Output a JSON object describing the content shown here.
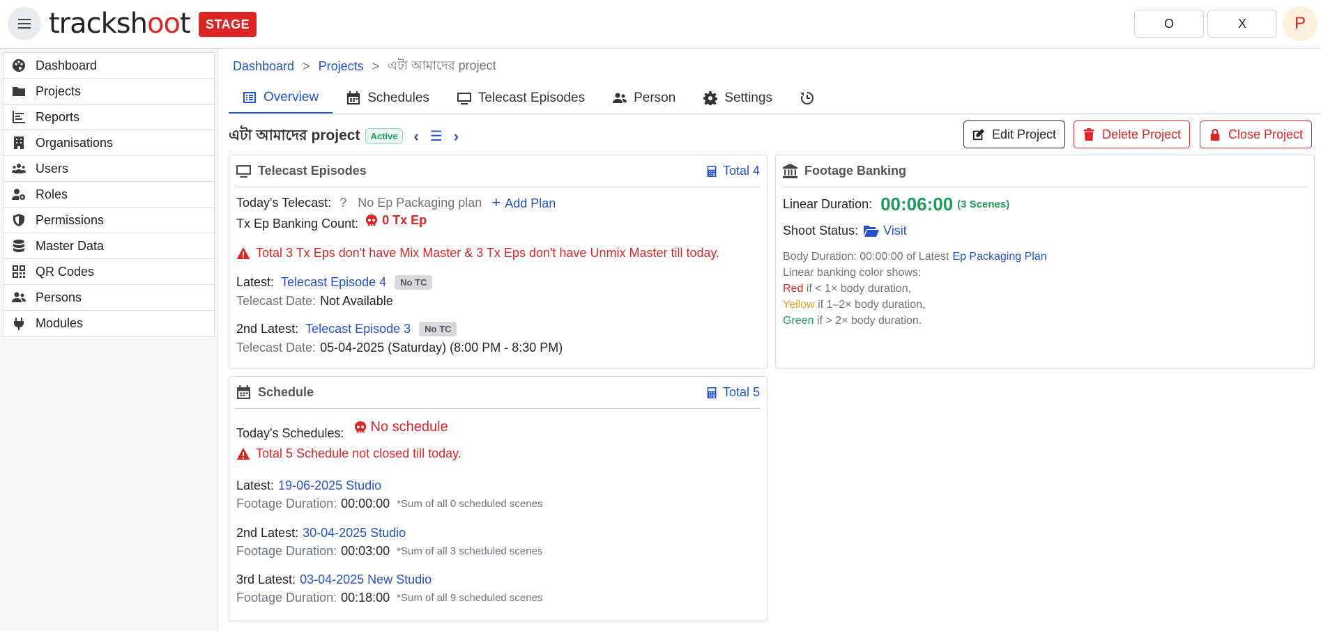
{
  "header": {
    "logo_text_a": "tracksh",
    "logo_text_b": "oo",
    "logo_text_c": "t",
    "stage_label": "STAGE",
    "btn_o_label": "O",
    "btn_x_label": "X",
    "avatar_letter": "P"
  },
  "sidebar": {
    "items": [
      {
        "label": "Dashboard",
        "icon": "palette-icon"
      },
      {
        "label": "Projects",
        "icon": "folder-icon"
      },
      {
        "label": "Reports",
        "icon": "chart-bar-icon"
      },
      {
        "label": "Organisations",
        "icon": "building-icon"
      },
      {
        "label": "Users",
        "icon": "users-icon"
      },
      {
        "label": "Roles",
        "icon": "user-gear-icon"
      },
      {
        "label": "Permissions",
        "icon": "shield-icon"
      },
      {
        "label": "Master Data",
        "icon": "database-icon"
      },
      {
        "label": "QR Codes",
        "icon": "qrcode-icon"
      },
      {
        "label": "Persons",
        "icon": "user-group-icon"
      },
      {
        "label": "Modules",
        "icon": "plug-icon"
      }
    ]
  },
  "breadcrumb": {
    "home": "Dashboard",
    "projects": "Projects",
    "current": "এটা আমাদের project",
    "sep": ">"
  },
  "tabs": [
    {
      "label": "Overview",
      "icon": "list-alt-icon",
      "active": true
    },
    {
      "label": "Schedules",
      "icon": "calendar-icon"
    },
    {
      "label": "Telecast Episodes",
      "icon": "tv-icon"
    },
    {
      "label": "Person",
      "icon": "user-group-icon"
    },
    {
      "label": "Settings",
      "icon": "gear-icon"
    },
    {
      "label": "",
      "icon": "history-icon"
    }
  ],
  "project": {
    "title": "এটা আমাদের project",
    "status": "Active",
    "edit_label": "Edit Project",
    "delete_label": "Delete Project",
    "close_label": "Close Project"
  },
  "telecast": {
    "title": "Telecast Episodes",
    "total": "Total 4",
    "todays_label": "Today's Telecast:",
    "todays_q": "?",
    "no_plan": "No Ep Packaging plan",
    "add_plan": "Add Plan",
    "banking_label": "Tx Ep Banking Count:",
    "banking_value": "0 Tx Ep",
    "warning": "Total 3 Tx Eps don't have Mix Master & 3 Tx Eps don't have Unmix Master till today.",
    "latest_label": "Latest:",
    "latest_ep": "Telecast Episode 4",
    "latest_badge": "No TC",
    "latest_date_label": "Telecast Date:",
    "latest_date": "Not Available",
    "second_label": "2nd Latest:",
    "second_ep": "Telecast Episode 3",
    "second_badge": "No TC",
    "second_date_label": "Telecast Date:",
    "second_date": "05-04-2025 (Saturday) (8:00 PM - 8:30 PM)"
  },
  "footage": {
    "title": "Footage Banking",
    "linear_label": "Linear Duration:",
    "linear_value": "00:06:00",
    "scenes": "(3 Scenes)",
    "shoot_label": "Shoot Status:",
    "visit": "Visit",
    "body_text": "Body Duration: 00:00:00 of Latest",
    "body_link": "Ep Packaging Plan",
    "legend_intro": "Linear banking color shows:",
    "legend_red": "Red",
    "legend_red_rest": " if < 1× body duration,",
    "legend_yellow": "Yellow",
    "legend_yellow_rest": " if 1–2× body duration,",
    "legend_green": "Green",
    "legend_green_rest": " if > 2× body duration."
  },
  "schedule": {
    "title": "Schedule",
    "total": "Total 5",
    "todays_label": "Today's Schedules:",
    "no_schedule": "No schedule",
    "warning": "Total 5 Schedule not closed till today.",
    "items": [
      {
        "label": "Latest:",
        "link": "19-06-2025 Studio",
        "dur_label": "Footage Duration:",
        "dur": "00:00:00",
        "note": "*Sum of all 0 scheduled scenes"
      },
      {
        "label": "2nd Latest:",
        "link": "30-04-2025 Studio",
        "dur_label": "Footage Duration:",
        "dur": "00:03:00",
        "note": "*Sum of all 3 scheduled scenes"
      },
      {
        "label": "3rd Latest:",
        "link": "03-04-2025 New Studio",
        "dur_label": "Footage Duration:",
        "dur": "00:18:00",
        "note": "*Sum of all 9 scheduled scenes"
      }
    ]
  },
  "colors": {
    "accent": "#2552d0",
    "danger": "#dc2626",
    "success": "#1e9c5a",
    "warning": "#e3a22b"
  }
}
